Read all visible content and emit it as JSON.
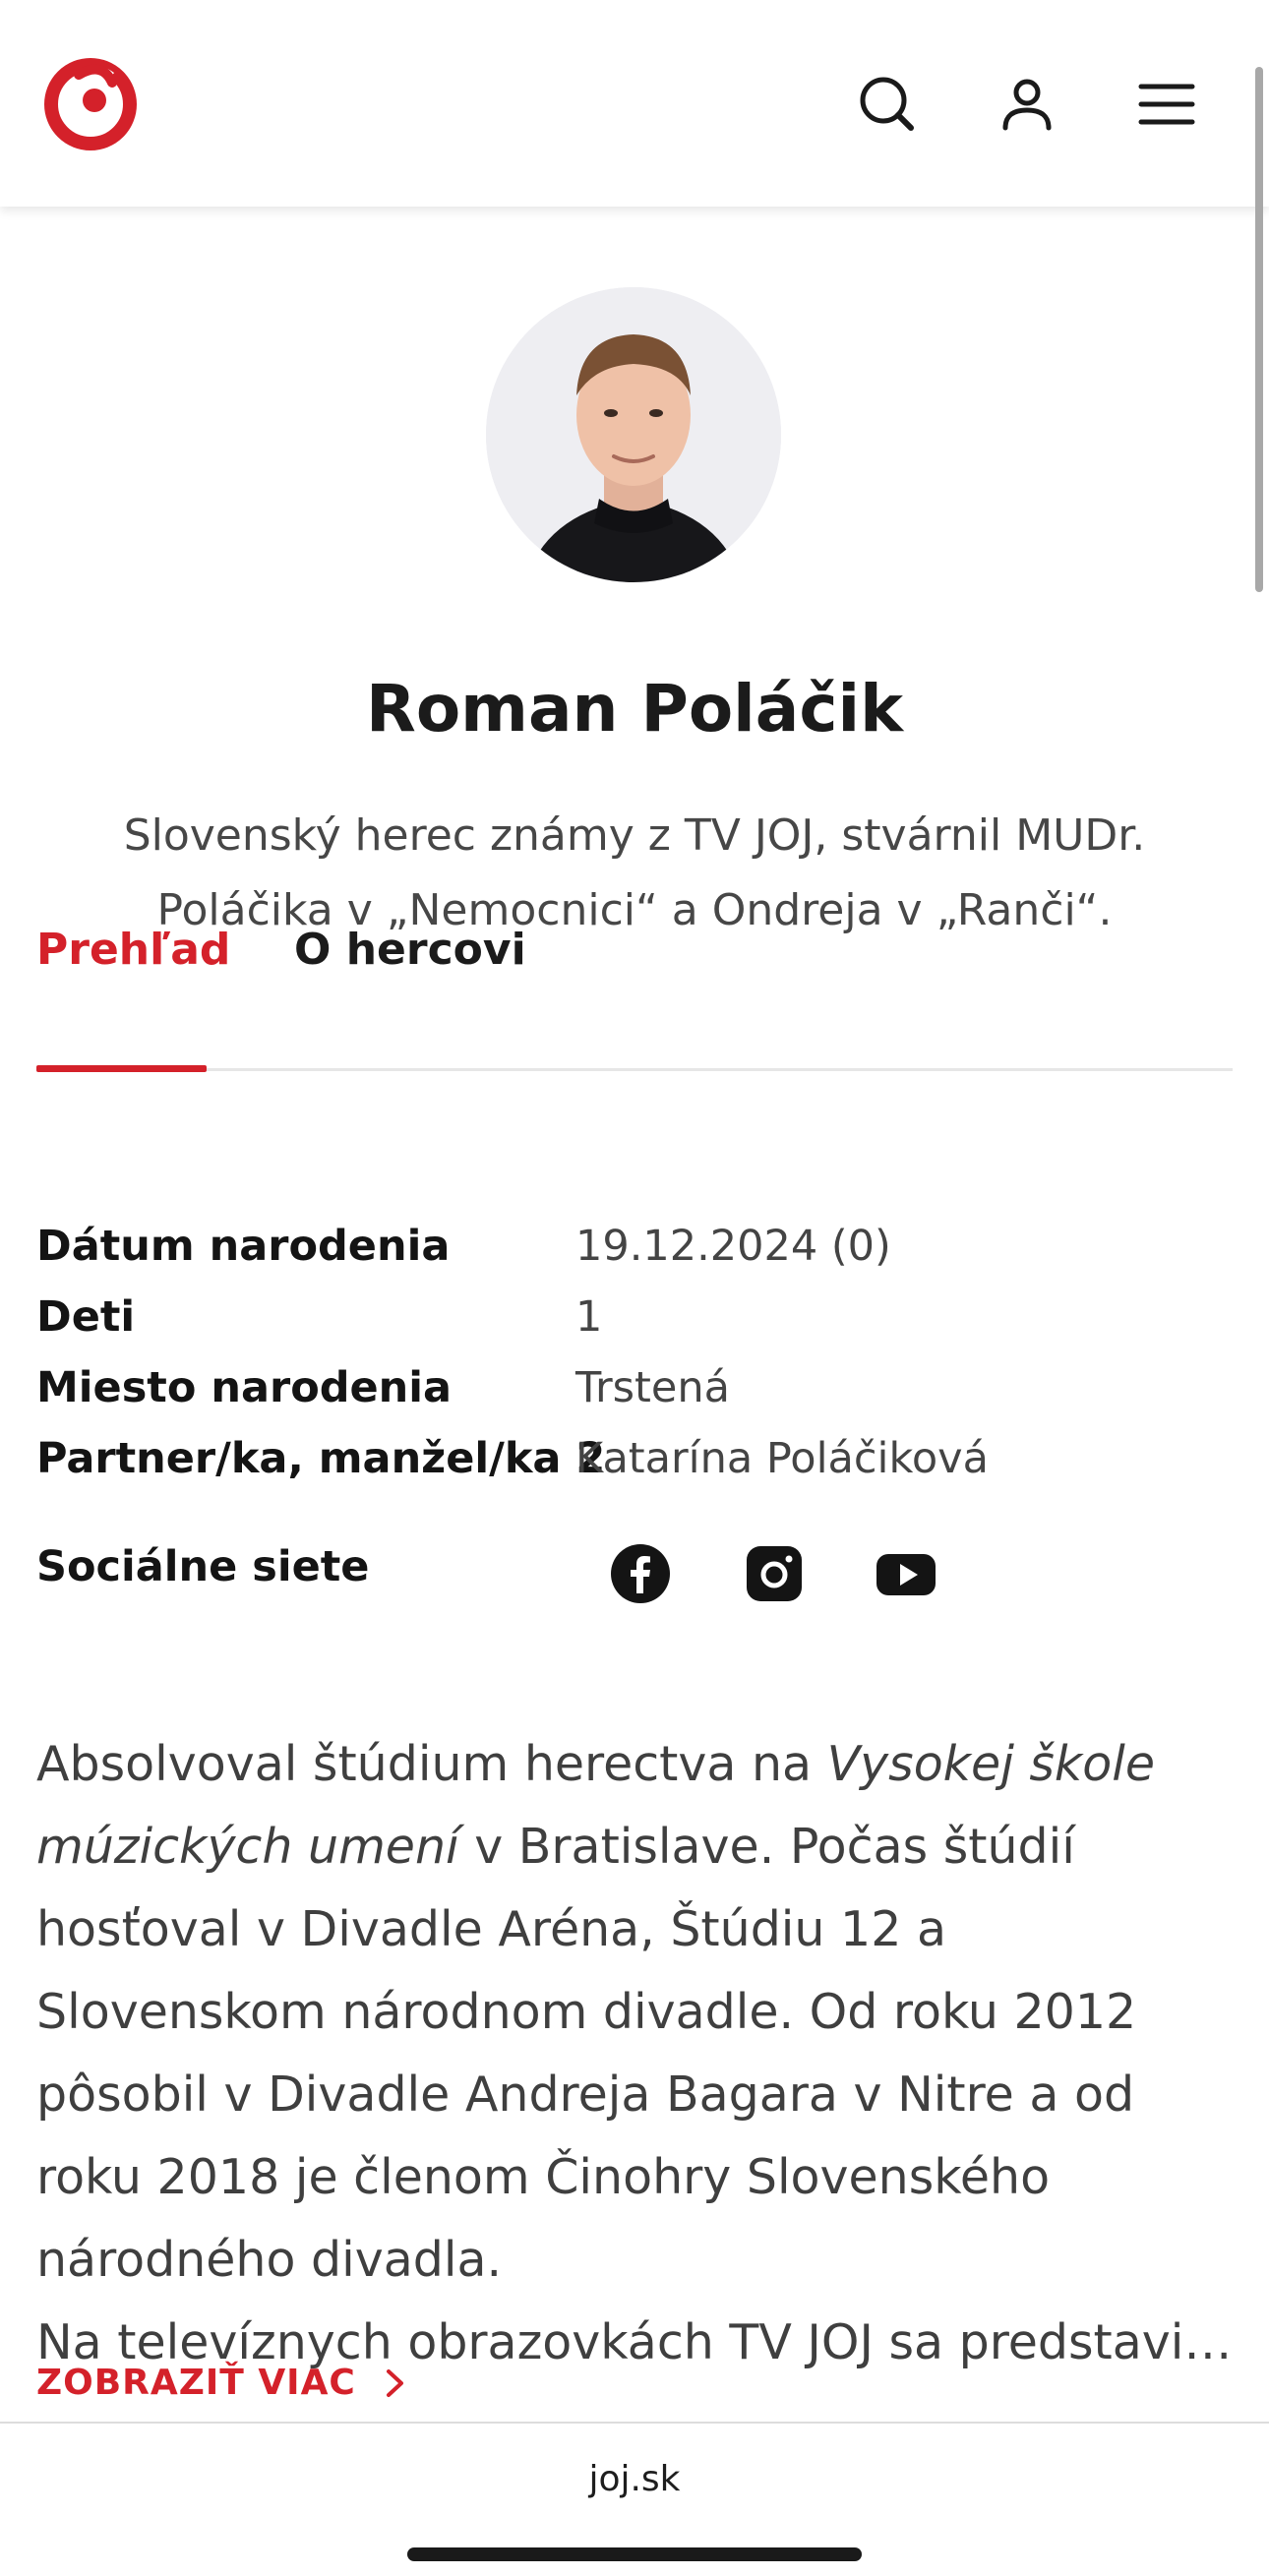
{
  "header": {
    "logo": "joj-logo",
    "search_icon": "search-icon",
    "user_icon": "user-icon",
    "menu_icon": "hamburger-menu-icon"
  },
  "profile": {
    "name": "Roman Poláčik",
    "subtitle": "Slovenský herec známy z TV JOJ, stvárnil MUDr. Poláčika v „Nemocnici“ a Ondreja v „Ranči“."
  },
  "tabs": [
    {
      "label": "Prehľad",
      "active": true
    },
    {
      "label": "O hercovi",
      "active": false
    }
  ],
  "info": [
    {
      "label": "Dátum narodenia",
      "value": "19.12.2024 (0)"
    },
    {
      "label": "Deti",
      "value": "1"
    },
    {
      "label": "Miesto narodenia",
      "value": "Trstená"
    },
    {
      "label": "Partner/ka, manžel/ka 2",
      "value": "Katarína Poláčiková"
    }
  ],
  "social": {
    "label": "Sociálne siete",
    "icons": [
      "facebook-icon",
      "instagram-icon",
      "youtube-icon"
    ]
  },
  "bio": {
    "p1_before": "Absolvoval štúdium herectva na ",
    "p1_italic": "Vysokej škole múzických umení",
    "p1_after": " v Bratislave. Počas štúdií hosťoval v Divadle Aréna, Štúdiu 12 a Slovenskom národnom divadle. Od roku 2012 pôsobil v Divadle Andreja Bagara v Nitre a od roku 2018 je členom Činohry Slovenského národného divadla.",
    "p2": "Na televíznych obrazovkách TV JOJ sa predstavil …"
  },
  "more_label": "ZOBRAZIŤ VIAC",
  "footer": {
    "url": "joj.sk"
  },
  "colors": {
    "accent": "#d4212a",
    "text": "#1b1b1b",
    "muted": "#444444"
  }
}
